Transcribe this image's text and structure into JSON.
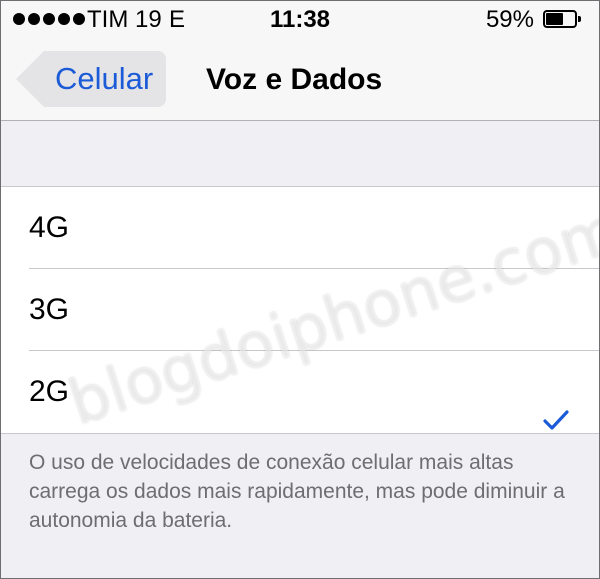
{
  "status_bar": {
    "carrier": "TIM 19",
    "network": "E",
    "time": "11:38",
    "battery_percent": "59%",
    "battery_level": 0.59,
    "signal_bars": 5
  },
  "nav": {
    "back_label": "Celular",
    "title": "Voz e Dados"
  },
  "options": [
    {
      "label": "4G",
      "selected": false
    },
    {
      "label": "3G",
      "selected": false
    },
    {
      "label": "2G",
      "selected": true
    }
  ],
  "footer_text": "O uso de velocidades de conexão celular mais altas carrega os dados mais rapidamente, mas pode diminuir a autonomia da bateria.",
  "watermark": "blogdoiphone.com",
  "colors": {
    "accent": "#1c5bd7",
    "background": "#efeff4"
  },
  "icons": {
    "back": "chevron-left-icon",
    "check": "checkmark-icon",
    "battery": "battery-icon",
    "signal": "signal-dots-icon"
  }
}
